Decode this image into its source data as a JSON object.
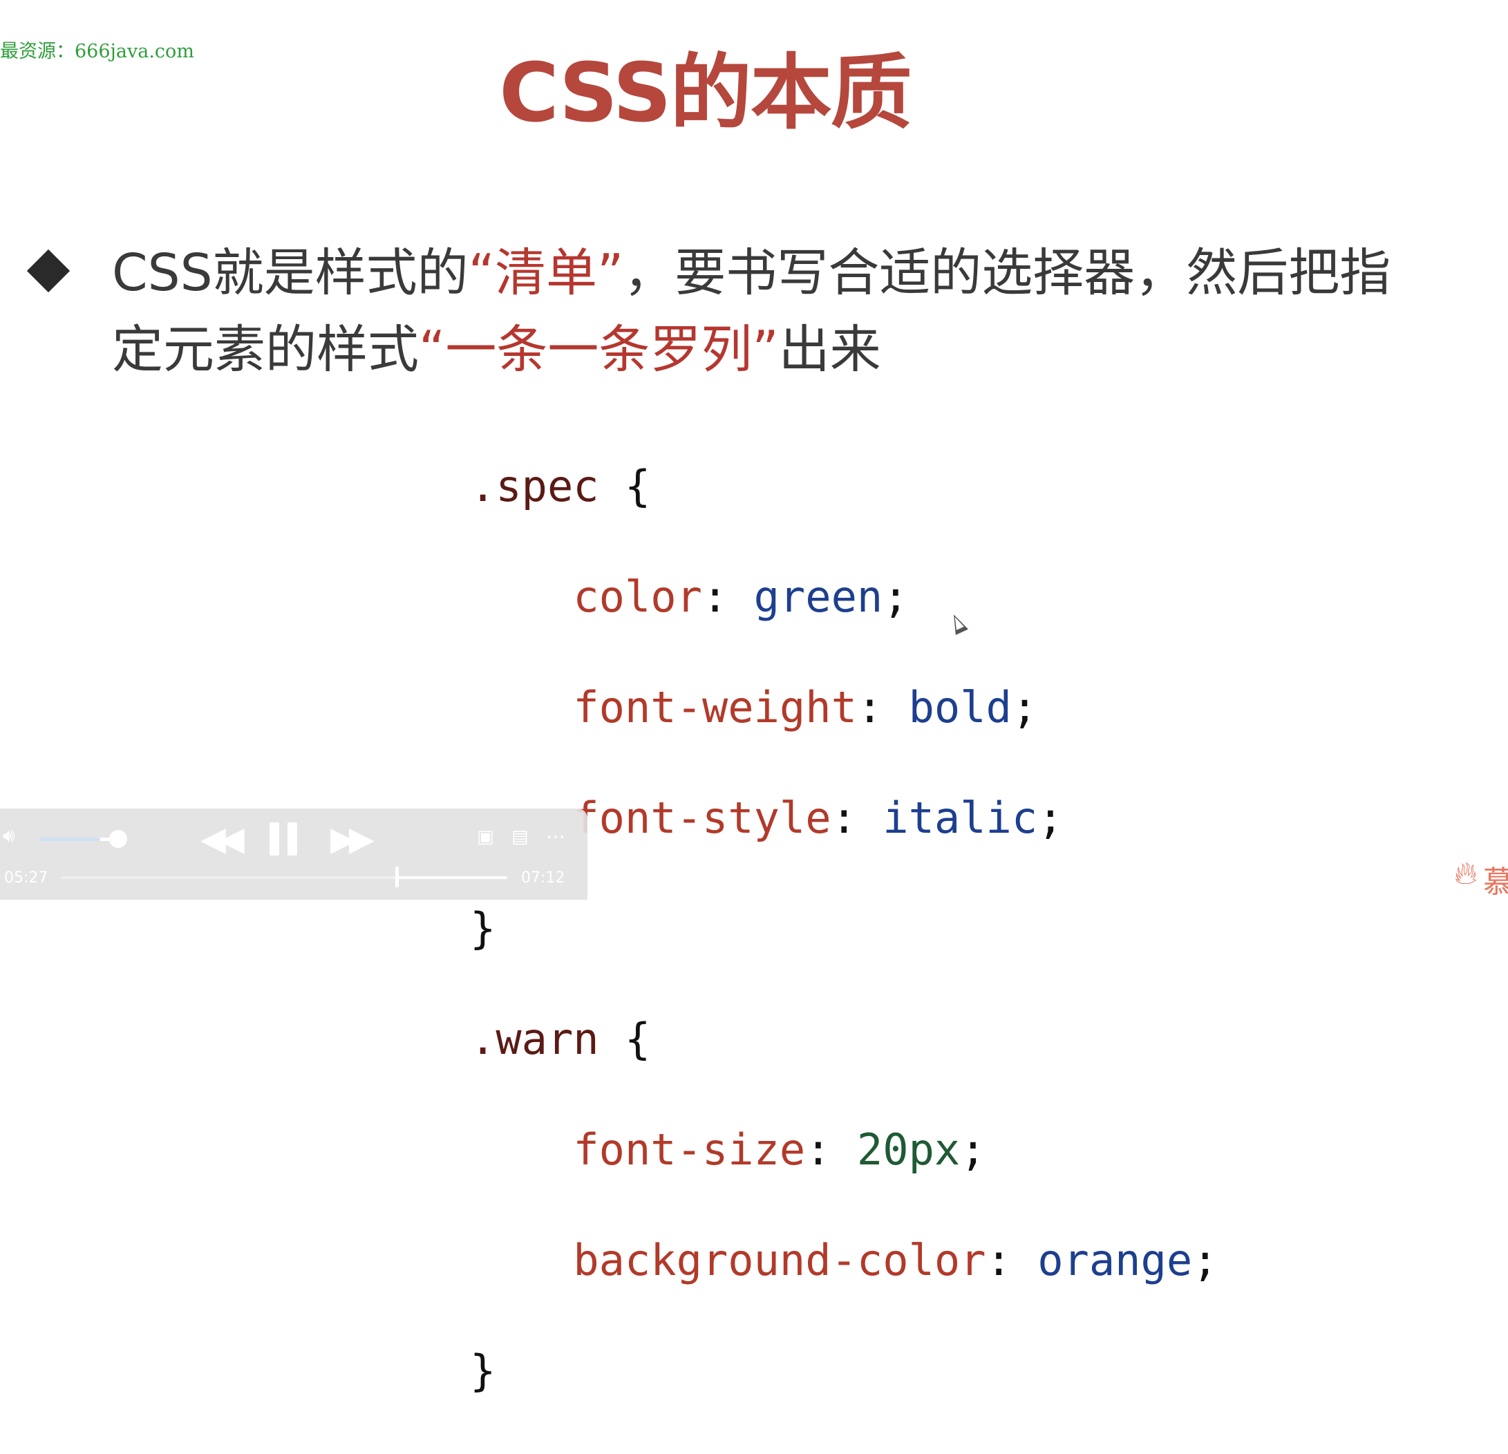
{
  "watermark": "最资源：666java.com",
  "slide": {
    "title": "CSS的本质",
    "bullet": {
      "text_1": "CSS就是样式的",
      "highlight_1": "“清单”",
      "text_2": "，要书写合适的选择器，然后把指定元素的样式",
      "highlight_2": "“一条一条罗列”",
      "text_3": "出来"
    },
    "code": {
      "spec_selector": ".spec",
      "spec_rules": [
        {
          "prop": "color",
          "value": "green"
        },
        {
          "prop": "font-weight",
          "value": "bold"
        },
        {
          "prop": "font-style",
          "value": "italic"
        }
      ],
      "warn_selector": ".warn",
      "warn_rules": [
        {
          "prop": "font-size",
          "value": "20px"
        },
        {
          "prop": "background-color",
          "value": "orange"
        }
      ],
      "open_brace": "{",
      "close_brace": "}",
      "colon": ":",
      "semicolon": ";"
    }
  },
  "player": {
    "current_time": "05:27",
    "total_time": "07:12",
    "progress": 0.757,
    "volume": 0.75,
    "icons": {
      "volume": "volume-icon",
      "rewind": "rewind-icon",
      "pause": "pause-icon",
      "forward": "fast-forward-icon",
      "pip": "picture-in-picture-icon",
      "captions": "captions-icon",
      "more": "more-icon"
    }
  },
  "brand": {
    "logo": "flame-logo-icon",
    "text": "慕"
  },
  "colors": {
    "title": "#b5473d",
    "highlight": "#b5372f",
    "property": "#b23a2a",
    "value": "#1d3f8f",
    "watermark": "#2f9e3a"
  }
}
